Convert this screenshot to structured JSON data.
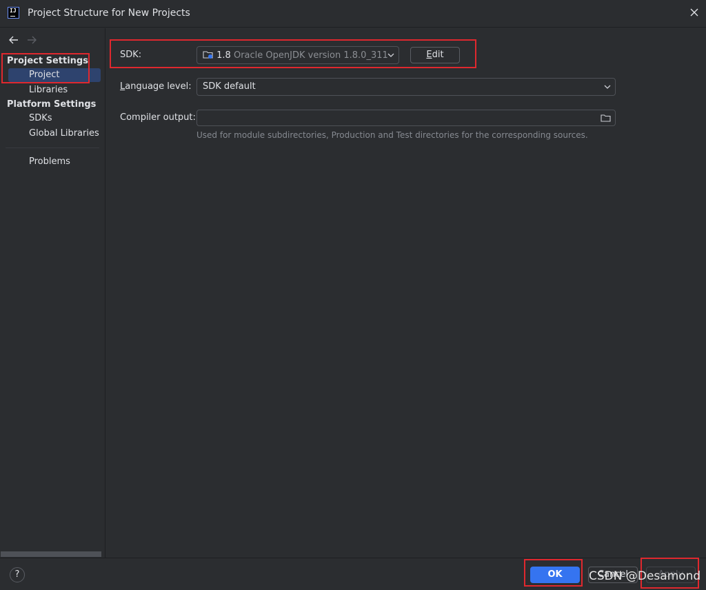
{
  "window": {
    "title": "Project Structure for New Projects",
    "app_icon_text": "IJ"
  },
  "sidebar": {
    "project_settings_header": "Project Settings",
    "project_settings_items": [
      {
        "label": "Project",
        "selected": true
      },
      {
        "label": "Libraries",
        "selected": false
      }
    ],
    "platform_settings_header": "Platform Settings",
    "platform_settings_items": [
      {
        "label": "SDKs"
      },
      {
        "label": "Global Libraries"
      }
    ],
    "problems_label": "Problems"
  },
  "form": {
    "sdk": {
      "label": "SDK:",
      "version": "1.8",
      "description": "Oracle OpenJDK version 1.8.0_311",
      "edit_button_mnemonic": "E",
      "edit_button_rest": "dit"
    },
    "language_level": {
      "label_mnemonic": "L",
      "label_rest": "anguage level:",
      "value": "SDK default"
    },
    "compiler_output": {
      "label": "Compiler output:",
      "value": "",
      "hint": "Used for module subdirectories, Production and Test directories for the corresponding sources."
    }
  },
  "footer": {
    "help_label": "?",
    "ok_label": "OK",
    "cancel_label": "Cancel",
    "apply_label": "Apply"
  },
  "watermark": "CSDN @Desamond",
  "colors": {
    "background": "#2b2d30",
    "selection": "#2e436e",
    "primary_button": "#3574f0",
    "annotation": "#e0282e"
  }
}
